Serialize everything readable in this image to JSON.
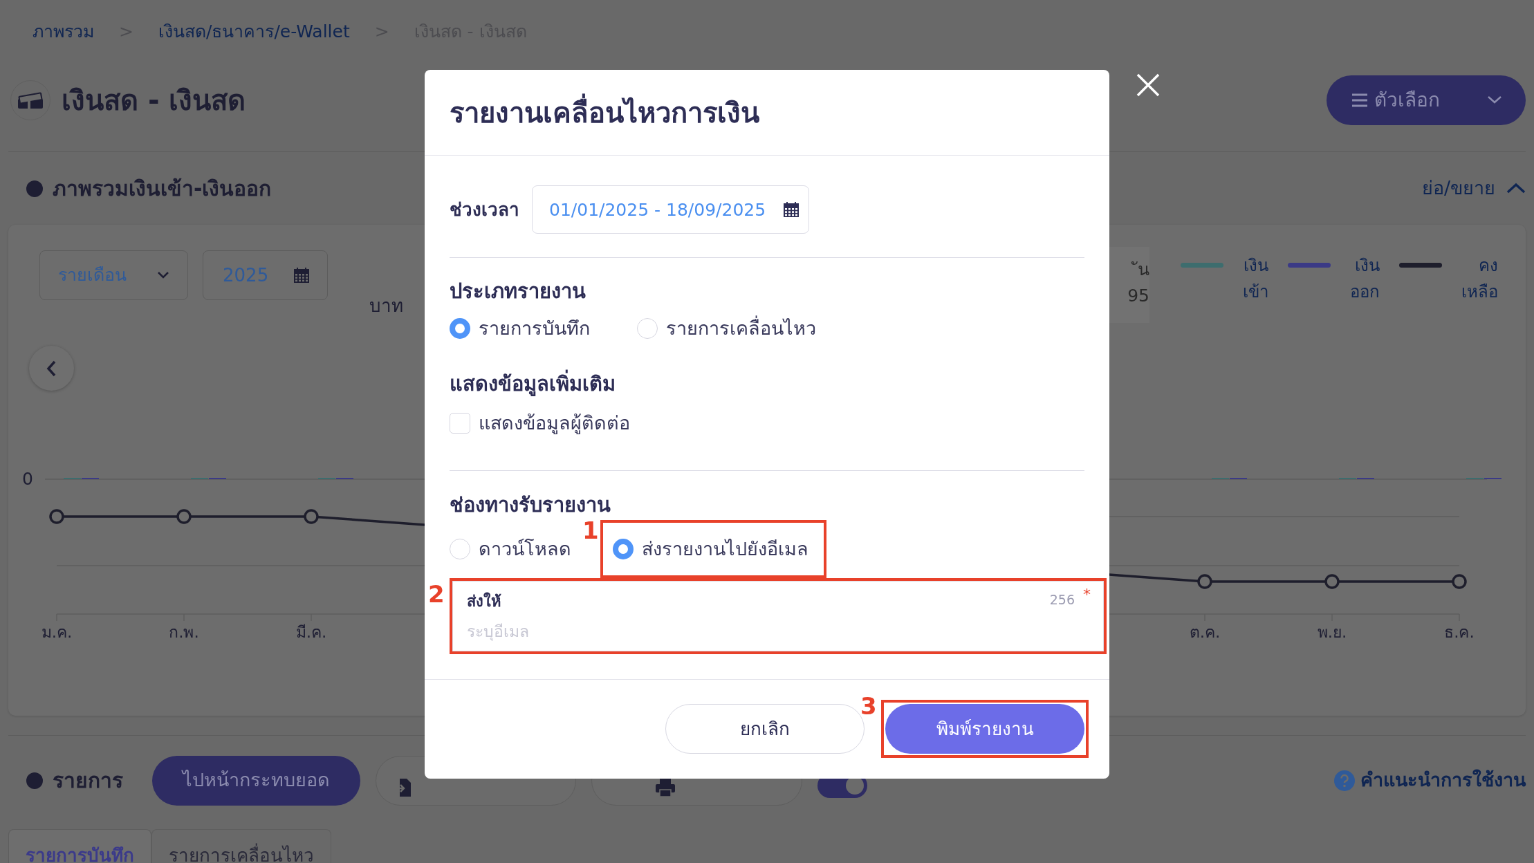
{
  "breadcrumb": [
    {
      "label": "ภาพรวม",
      "link": true
    },
    {
      "label": "เงินสด/ธนาคาร/e-Wallet",
      "link": true
    },
    {
      "label": "เงินสด - เงินสด",
      "link": false
    }
  ],
  "breadcrumb_separators": [
    ">",
    ">"
  ],
  "page_title": "เงินสด - เงินสด",
  "options_button": {
    "label": "ตัวเลือก"
  },
  "overview": {
    "title": "ภาพรวมเงินเข้า-เงินออก",
    "collapse_label": "ย่อ/ขยาย",
    "expanded": true,
    "period_select": "รายเดือน",
    "year_field": "2025",
    "unit": "บาท",
    "summary_fragment": [
      "ัน",
      "95"
    ],
    "zero_label": "0",
    "month_labels": [
      "ม.ค.",
      "ก.พ.",
      "มี.ค.",
      "ต.ค.",
      "พ.ย.",
      "ธ.ค."
    ],
    "legend": [
      {
        "label": "เงิน เข้า",
        "color": "#3d6d6e"
      },
      {
        "label": "เงิน ออก",
        "color": "#3b3a86"
      },
      {
        "label": "คง เหลือ",
        "color": "#1e1e2c"
      }
    ]
  },
  "list_section": {
    "title": "รายการ",
    "reconcile_button": "ไปหน้ากระทบยอด",
    "toggle_on": true,
    "help_link": "คำแนะนำการใช้งาน",
    "tabs": [
      {
        "label": "รายการบันทึก",
        "selected": true
      },
      {
        "label": "รายการเคลื่อนไหว",
        "selected": false
      }
    ]
  },
  "modal": {
    "title": "รายงานเคลื่อนไหวการเงิน",
    "period_label": "ช่วงเวลา",
    "period_value": "01/01/2025 - 18/09/2025",
    "report_type": {
      "heading": "ประเภทรายงาน",
      "options": [
        {
          "label": "รายการบันทึก",
          "selected": true
        },
        {
          "label": "รายการเคลื่อนไหว",
          "selected": false
        }
      ]
    },
    "extra": {
      "heading": "แสดงข้อมูลเพิ่มเติม",
      "options": [
        {
          "label": "แสดงข้อมูลผู้ติดต่อ",
          "checked": false
        }
      ]
    },
    "delivery": {
      "heading": "ช่องทางรับรายงาน",
      "options": [
        {
          "label": "ดาวน์โหลด",
          "selected": false
        },
        {
          "label": "ส่งรายงานไปยังอีเมล",
          "selected": true,
          "annotation": "1"
        }
      ]
    },
    "email_field": {
      "label": "ส่งให้",
      "counter": "256",
      "required_mark": "*",
      "placeholder": "ระบุอีเมล",
      "annotation": "2"
    },
    "buttons": [
      {
        "label": "ยกเลิก",
        "kind": "secondary"
      },
      {
        "label": "พิมพ์รายงาน",
        "kind": "primary",
        "annotation": "3"
      }
    ]
  }
}
